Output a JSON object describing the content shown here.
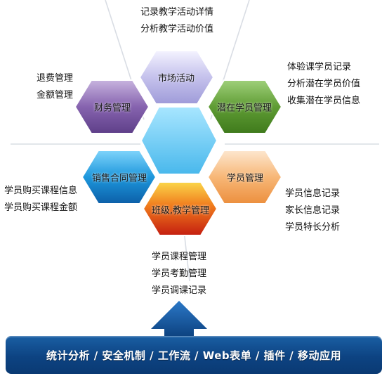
{
  "modules": {
    "market": "市场活动",
    "prospect": "潜在学员管理",
    "student": "学员管理",
    "teaching": "班级,教学管理",
    "contract": "销售合同管理",
    "finance": "财务管理"
  },
  "notes": {
    "market": [
      "记录教学活动详情",
      "分析教学活动价值"
    ],
    "prospect": [
      "体验课学员记录",
      "分析潜在学员价值",
      "收集潜在学员信息"
    ],
    "student": [
      "学员信息记录",
      "家长信息记录",
      "学员特长分析"
    ],
    "teaching": [
      "学员课程管理",
      "学员考勤管理",
      "学员调课记录"
    ],
    "contract": [
      "学员购买课程信息",
      "学员购买课程金额"
    ],
    "finance": [
      "退费管理",
      "金额管理"
    ]
  },
  "footer": {
    "text": "统计分析 / 安全机制 / 工作流 / Web表单 / 插件 / 移动应用"
  },
  "colors": {
    "market": "#b8b5e6",
    "prospect": "#5e9a32",
    "student": "#f0a860",
    "teaching": "#e23a10",
    "contract": "#1a8fd6",
    "finance": "#7e59a6",
    "center": "#6ecbf5",
    "footer": "#0d4382"
  }
}
